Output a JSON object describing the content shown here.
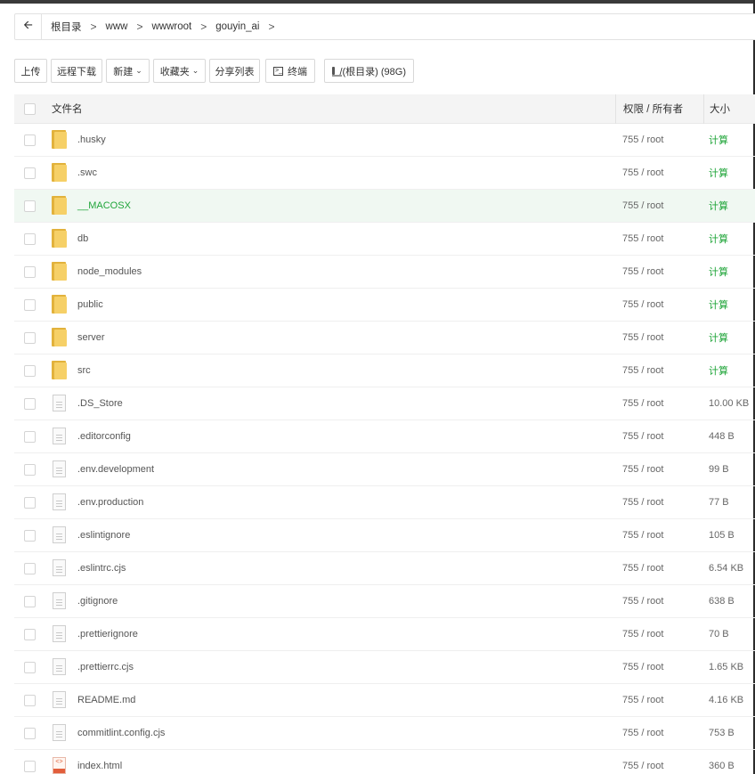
{
  "breadcrumb": {
    "items": [
      "根目录",
      "www",
      "wwwroot",
      "gouyin_ai"
    ],
    "separator": ">"
  },
  "toolbar": {
    "upload": "上传",
    "remote_download": "远程下载",
    "new": "新建",
    "favorites": "收藏夹",
    "share_list": "分享列表",
    "terminal": "终端",
    "disk": "/(根目录) (98G)"
  },
  "table": {
    "headers": {
      "name": "文件名",
      "perm": "权限 / 所有者",
      "size": "大小"
    },
    "rows": [
      {
        "name": ".husky",
        "type": "folder",
        "perm": "755 / root",
        "size": "计算"
      },
      {
        "name": ".swc",
        "type": "folder",
        "perm": "755 / root",
        "size": "计算"
      },
      {
        "name": "__MACOSX",
        "type": "folder",
        "perm": "755 / root",
        "size": "计算",
        "highlight": true
      },
      {
        "name": "db",
        "type": "folder",
        "perm": "755 / root",
        "size": "计算"
      },
      {
        "name": "node_modules",
        "type": "folder",
        "perm": "755 / root",
        "size": "计算"
      },
      {
        "name": "public",
        "type": "folder",
        "perm": "755 / root",
        "size": "计算"
      },
      {
        "name": "server",
        "type": "folder",
        "perm": "755 / root",
        "size": "计算"
      },
      {
        "name": "src",
        "type": "folder",
        "perm": "755 / root",
        "size": "计算"
      },
      {
        "name": ".DS_Store",
        "type": "file",
        "perm": "755 / root",
        "size": "10.00 KB"
      },
      {
        "name": ".editorconfig",
        "type": "file",
        "perm": "755 / root",
        "size": "448 B"
      },
      {
        "name": ".env.development",
        "type": "file",
        "perm": "755 / root",
        "size": "99 B"
      },
      {
        "name": ".env.production",
        "type": "file",
        "perm": "755 / root",
        "size": "77 B"
      },
      {
        "name": ".eslintignore",
        "type": "file",
        "perm": "755 / root",
        "size": "105 B"
      },
      {
        "name": ".eslintrc.cjs",
        "type": "file",
        "perm": "755 / root",
        "size": "6.54 KB"
      },
      {
        "name": ".gitignore",
        "type": "file",
        "perm": "755 / root",
        "size": "638 B"
      },
      {
        "name": ".prettierignore",
        "type": "file",
        "perm": "755 / root",
        "size": "70 B"
      },
      {
        "name": ".prettierrc.cjs",
        "type": "file",
        "perm": "755 / root",
        "size": "1.65 KB"
      },
      {
        "name": "README.md",
        "type": "file",
        "perm": "755 / root",
        "size": "4.16 KB"
      },
      {
        "name": "commitlint.config.cjs",
        "type": "file",
        "perm": "755 / root",
        "size": "753 B"
      },
      {
        "name": "index.html",
        "type": "html",
        "perm": "755 / root",
        "size": "360 B"
      }
    ]
  },
  "colors": {
    "accent": "#20a53a",
    "folder": "#f6d067",
    "highlight_row": "#f0f8f2"
  }
}
